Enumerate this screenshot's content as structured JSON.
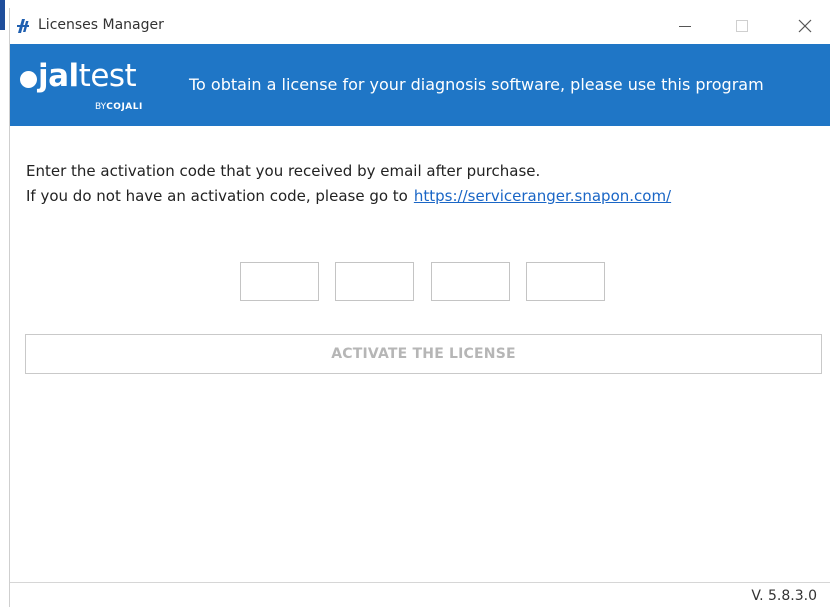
{
  "window": {
    "title": "Licenses Manager",
    "icon": "jaltest-app-icon",
    "controls": [
      "minimize-icon",
      "maximize-icon",
      "close-icon"
    ]
  },
  "banner": {
    "logo_main": "jal",
    "logo_suffix": "test",
    "logo_by": "BY",
    "logo_brand": "COJALI",
    "tagline": "To obtain a license for your diagnosis software, please use this program",
    "background_color": "#1f76c6"
  },
  "instructions": {
    "line1": "Enter the activation code that you received by email after purchase.",
    "line2_prefix": "If you do not have an activation code, please go to",
    "link": "https://serviceranger.snapon.com/"
  },
  "activation_code": {
    "fields": [
      {
        "value": ""
      },
      {
        "value": ""
      },
      {
        "value": ""
      },
      {
        "value": ""
      }
    ]
  },
  "activate_button": {
    "label": "ACTIVATE THE LICENSE",
    "state": "disabled"
  },
  "footer": {
    "version": "V. 5.8.3.0"
  }
}
